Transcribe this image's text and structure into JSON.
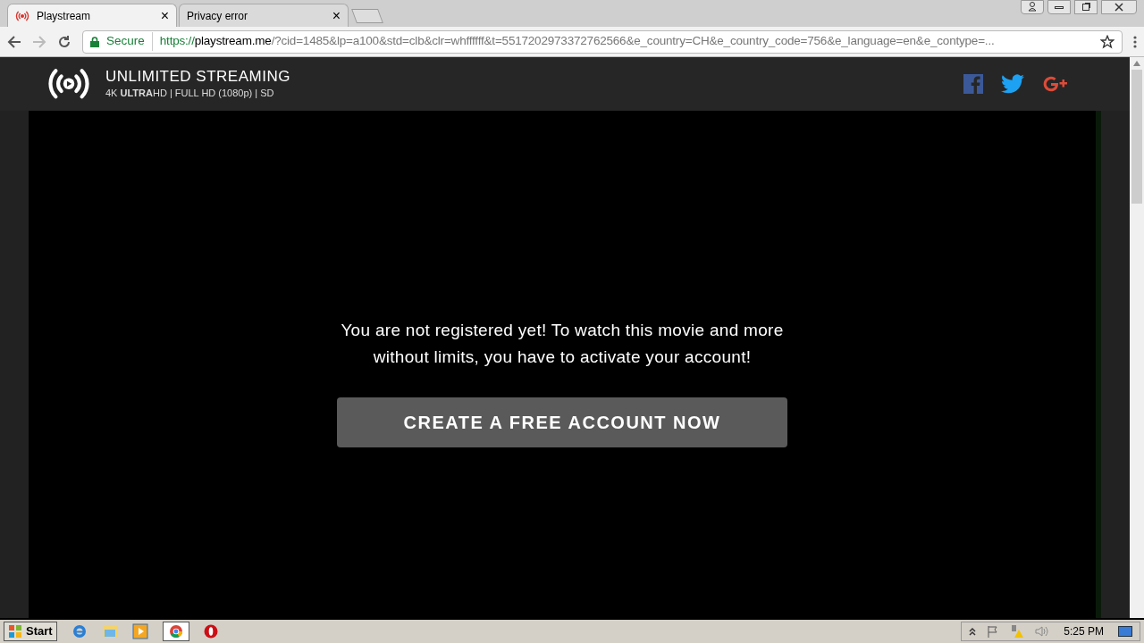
{
  "tabs": [
    {
      "title": "Playstream",
      "selected": true,
      "close": "×"
    },
    {
      "title": "Privacy error",
      "selected": false,
      "close": "×"
    }
  ],
  "address_bar": {
    "security": "Secure",
    "scheme": "https://",
    "host": "playstream.me",
    "path": "/?cid=1485&lp=a100&std=clb&clr=whffffff&t=5517202973372762566&e_country=CH&e_country_code=756&e_language=en&e_contype=..."
  },
  "site_header": {
    "title": "UNLIMITED STREAMING",
    "subtitle": "4K **ULTRA**HD | FULL HD (1080p) | SD"
  },
  "message": "You are not registered yet! To watch this movie and more without limits, you have to activate your account!",
  "cta_button": "CREATE A FREE ACCOUNT NOW",
  "taskbar": {
    "start": "Start",
    "clock": "5:25 PM"
  }
}
